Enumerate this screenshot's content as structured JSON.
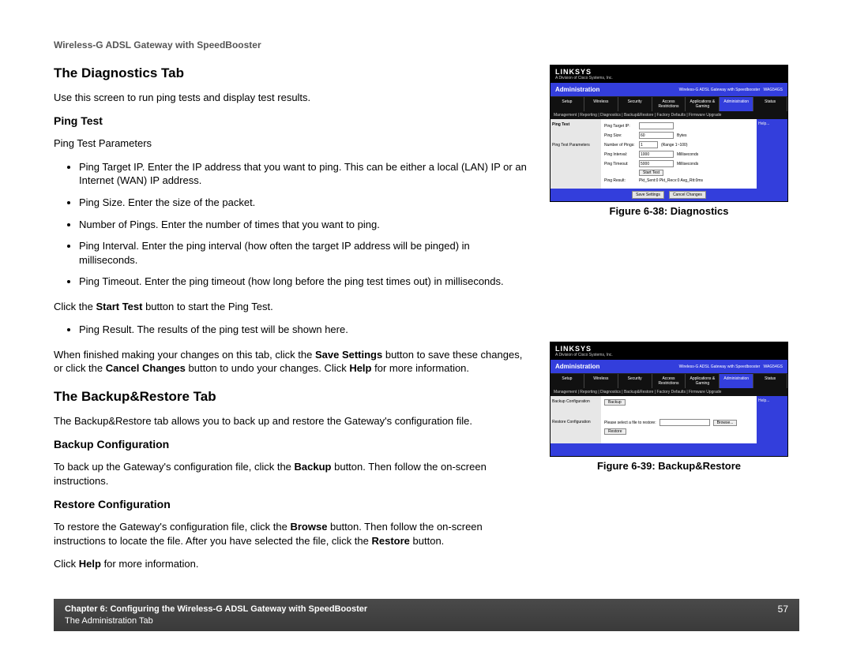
{
  "header": "Wireless-G ADSL Gateway with SpeedBooster",
  "diag": {
    "title": "The Diagnostics Tab",
    "intro": "Use this screen to run ping tests and display test results.",
    "ping_test_h": "Ping Test",
    "ping_params": "Ping Test Parameters",
    "bullets1": [
      "Ping Target IP. Enter the IP address that you want to ping. This can be either a local (LAN) IP or an Internet (WAN) IP address.",
      "Ping Size. Enter the size of the packet.",
      "Number of Pings. Enter the number of times that you want to ping.",
      "Ping Interval. Enter the ping interval (how often the target IP address will be pinged) in milliseconds.",
      "Ping Timeout. Enter the ping timeout (how long before the ping test times out) in milliseconds."
    ],
    "start_pre": "Click the ",
    "start_b": "Start Test",
    "start_post": " button to start the Ping Test.",
    "bullets2": [
      "Ping Result. The results of the ping test will be shown here."
    ],
    "save_pre": "When finished making your changes on this tab, click the ",
    "save_b": "Save Settings",
    "save_mid": " button to save these changes, or click the ",
    "cancel_b": "Cancel Changes",
    "save_post1": " button to undo your changes. Click ",
    "help_b": "Help",
    "save_post2": " for more information."
  },
  "br": {
    "title": "The Backup&Restore Tab",
    "intro": "The Backup&Restore tab allows you to back up and restore the Gateway's configuration file.",
    "backup_h": "Backup Configuration",
    "backup_pre": "To back up the Gateway's configuration file, click the ",
    "backup_b": "Backup",
    "backup_post": " button. Then follow the on-screen instructions.",
    "restore_h": "Restore Configuration",
    "restore_pre": "To restore the Gateway's configuration file, click the ",
    "browse_b": "Browse",
    "restore_mid": " button. Then follow the on-screen instructions to locate the file. After you have selected the file, click the ",
    "restore_b": "Restore",
    "restore_post": " button.",
    "help_pre": "Click ",
    "help_b": "Help",
    "help_post": " for more information."
  },
  "figs": {
    "f38": "Figure 6-38: Diagnostics",
    "f39": "Figure 6-39: Backup&Restore"
  },
  "panel": {
    "logo": "LINKSYS",
    "sub": "A Division of Cisco Systems, Inc.",
    "gw": "Wireless-G ADSL Gateway with Speedbooster",
    "model": "WAG54GS",
    "admin": "Administration",
    "tabs": [
      "Setup",
      "Wireless",
      "Security",
      "Access Restrictions",
      "Applications & Gaming",
      "Administration",
      "Status"
    ],
    "subtabs_diag": "Management  |  Reporting  |  Diagnostics  |  Backup&Restore  |  Factory Defaults  |  Firmware Upgrade",
    "help": "Help...",
    "diag_side1": "Ping Test",
    "diag_side_sub": "Ping Test Parameters",
    "diag_rows": {
      "target": "Ping Target IP:",
      "size": "Ping Size:",
      "size_v": "60",
      "size_u": "Bytes",
      "num": "Number of Pings:",
      "num_v": "1",
      "num_u": "(Range 1~100)",
      "intv": "Ping Interval:",
      "intv_v": "1000",
      "intv_u": "Milliseconds",
      "to": "Ping Timeout:",
      "to_v": "5000",
      "to_u": "Milliseconds",
      "start": "Start Test",
      "result": "Ping Result:",
      "result_v": "Pkt_Sent:0 Pkt_Recv:0 Avg_Rtt:0ms"
    },
    "save": "Save Settings",
    "cancel": "Cancel Changes",
    "br_side1": "Backup Configuration",
    "br_side2": "Restore Configuration",
    "br_backup": "Backup",
    "br_prompt": "Please select a file to restore:",
    "br_browse": "Browse...",
    "br_restore": "Restore"
  },
  "footer": {
    "l1": "Chapter 6: Configuring the Wireless-G ADSL Gateway with SpeedBooster",
    "l2": "The Administration Tab",
    "page": "57"
  }
}
